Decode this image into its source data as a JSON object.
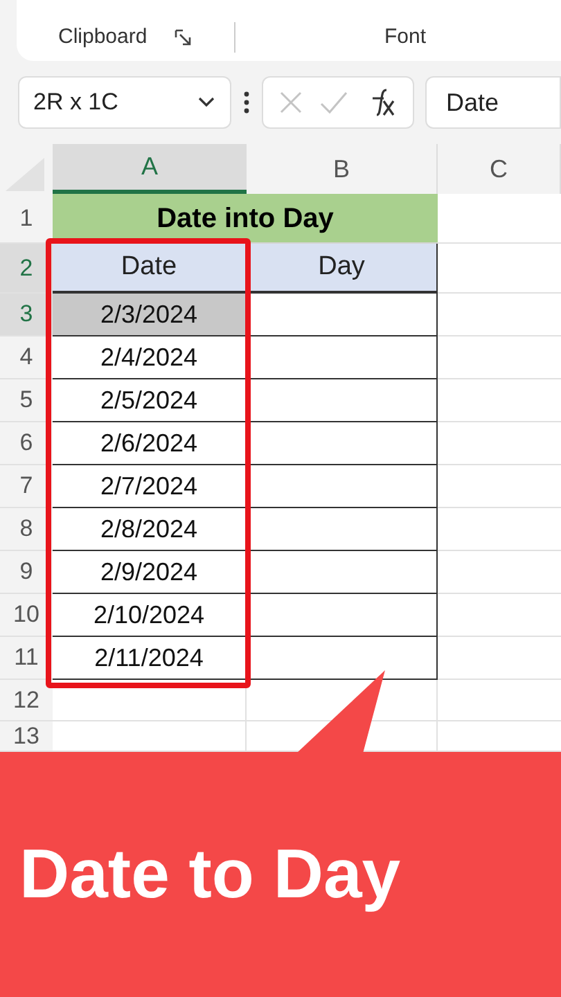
{
  "ribbon": {
    "groups": [
      {
        "label": "Clipboard",
        "launcher": true
      },
      {
        "label": "Font"
      }
    ]
  },
  "formula_bar": {
    "name_box": "2R x 1C",
    "value": "Date"
  },
  "columns": [
    {
      "label": "A",
      "selected": true
    },
    {
      "label": "B",
      "selected": false
    },
    {
      "label": "C",
      "selected": false
    }
  ],
  "rows": [
    {
      "header": "1",
      "kind": "title",
      "selected": false,
      "cells": [
        {
          "text": "Date into Day"
        }
      ]
    },
    {
      "header": "2",
      "kind": "header",
      "selected": true,
      "cells": [
        {
          "text": "Date"
        },
        {
          "text": "Day"
        }
      ]
    },
    {
      "header": "3",
      "kind": "data",
      "selected": true,
      "cells": [
        {
          "text": "2/3/2024",
          "selected": true
        }
      ]
    },
    {
      "header": "4",
      "kind": "data",
      "selected": false,
      "cells": [
        {
          "text": "2/4/2024",
          "selected": false
        }
      ]
    },
    {
      "header": "5",
      "kind": "data",
      "selected": false,
      "cells": [
        {
          "text": "2/5/2024",
          "selected": false
        }
      ]
    },
    {
      "header": "6",
      "kind": "data",
      "selected": false,
      "cells": [
        {
          "text": "2/6/2024",
          "selected": false
        }
      ]
    },
    {
      "header": "7",
      "kind": "data",
      "selected": false,
      "cells": [
        {
          "text": "2/7/2024",
          "selected": false
        }
      ]
    },
    {
      "header": "8",
      "kind": "data",
      "selected": false,
      "cells": [
        {
          "text": "2/8/2024",
          "selected": false
        }
      ]
    },
    {
      "header": "9",
      "kind": "data",
      "selected": false,
      "cells": [
        {
          "text": "2/9/2024",
          "selected": false
        }
      ]
    },
    {
      "header": "10",
      "kind": "data",
      "selected": false,
      "cells": [
        {
          "text": "2/10/2024",
          "selected": false
        }
      ]
    },
    {
      "header": "11",
      "kind": "data",
      "selected": false,
      "cells": [
        {
          "text": "2/11/2024",
          "selected": false
        }
      ]
    },
    {
      "header": "12",
      "kind": "empty",
      "selected": false,
      "cells": []
    },
    {
      "header": "13",
      "kind": "partial",
      "selected": false,
      "cells": []
    }
  ],
  "banner": {
    "caption": "Date to Day"
  }
}
